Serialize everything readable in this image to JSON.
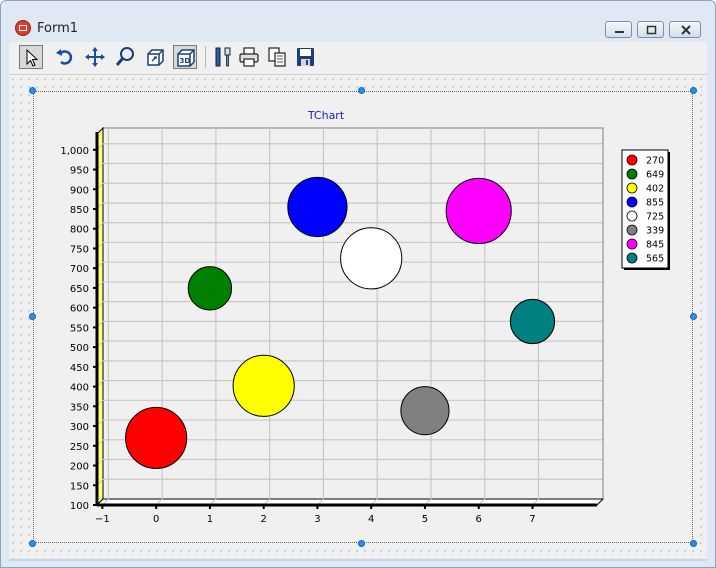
{
  "window": {
    "title": "Form1"
  },
  "toolbar": {
    "buttons": [
      {
        "icon": "pointer-icon",
        "pressed": true
      },
      {
        "icon": "rotate-icon",
        "pressed": false
      },
      {
        "icon": "move-icon",
        "pressed": false
      },
      {
        "icon": "zoom-icon",
        "pressed": false
      },
      {
        "icon": "depth-icon",
        "pressed": false
      },
      {
        "icon": "view-3d-icon",
        "pressed": true
      },
      {
        "icon": "edit-icon",
        "pressed": false
      },
      {
        "icon": "print-icon",
        "pressed": false
      },
      {
        "icon": "copy-icon",
        "pressed": false
      },
      {
        "icon": "save-icon",
        "pressed": false
      }
    ]
  },
  "chart_data": {
    "type": "bubble",
    "title": "TChart",
    "xlabel": "",
    "ylabel": "",
    "xlim": [
      -1.1,
      8.2
    ],
    "ylim": [
      100,
      1040
    ],
    "x_ticks": [
      -1,
      0,
      1,
      2,
      3,
      4,
      5,
      6,
      7
    ],
    "y_ticks": [
      100,
      150,
      200,
      250,
      300,
      350,
      400,
      450,
      500,
      550,
      600,
      650,
      700,
      750,
      800,
      850,
      900,
      950,
      1000
    ],
    "x_tick_labels": [
      "−1",
      "0",
      "1",
      "2",
      "3",
      "4",
      "5",
      "6",
      "7"
    ],
    "y_tick_labels": [
      "100",
      "150",
      "200",
      "250",
      "300",
      "350",
      "400",
      "450",
      "500",
      "550",
      "600",
      "650",
      "700",
      "750",
      "800",
      "850",
      "900",
      "950",
      "1,000"
    ],
    "grid": true,
    "legend_position": "right",
    "points": [
      {
        "x": 0,
        "y": 270,
        "radius_y": 155,
        "color": "#ff0000",
        "label": "270"
      },
      {
        "x": 1,
        "y": 649,
        "radius_y": 110,
        "color": "#008000",
        "label": "649"
      },
      {
        "x": 2,
        "y": 402,
        "radius_y": 155,
        "color": "#ffff00",
        "label": "402"
      },
      {
        "x": 3,
        "y": 855,
        "radius_y": 150,
        "color": "#0000ff",
        "label": "855"
      },
      {
        "x": 4,
        "y": 725,
        "radius_y": 155,
        "color": "#ffffff",
        "label": "725"
      },
      {
        "x": 5,
        "y": 339,
        "radius_y": 122,
        "color": "#808080",
        "label": "339"
      },
      {
        "x": 6,
        "y": 845,
        "radius_y": 165,
        "color": "#ff00ff",
        "label": "845"
      },
      {
        "x": 7,
        "y": 565,
        "radius_y": 112,
        "color": "#008080",
        "label": "565"
      }
    ]
  }
}
